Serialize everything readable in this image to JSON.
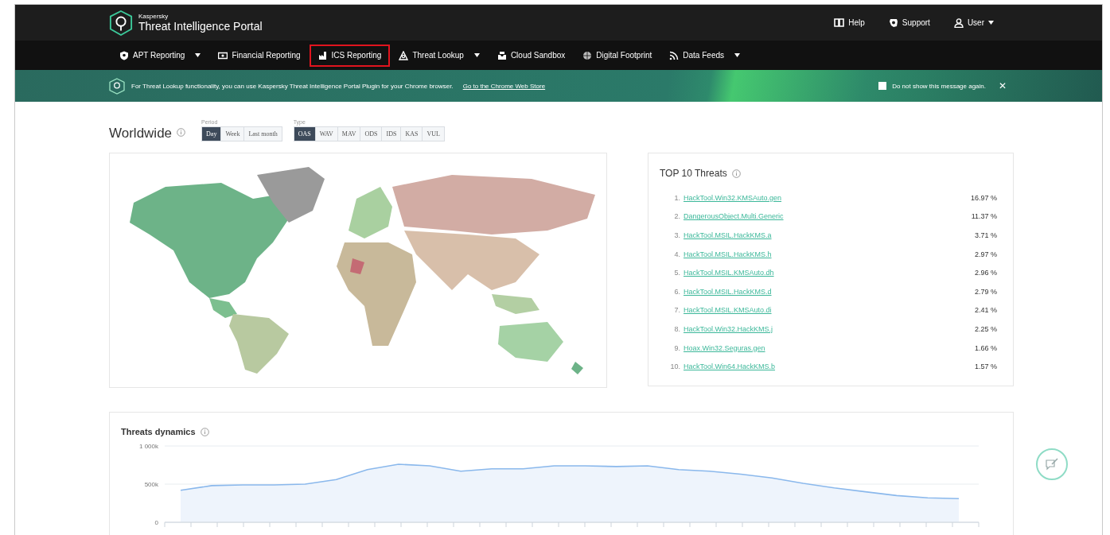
{
  "header": {
    "brand": "Kaspersky",
    "title": "Threat Intelligence Portal",
    "links": [
      {
        "label": "Help",
        "dropdown": false
      },
      {
        "label": "Support",
        "dropdown": false
      },
      {
        "label": "User",
        "dropdown": true
      }
    ]
  },
  "nav": [
    {
      "label": "APT Reporting",
      "dropdown": true,
      "highlighted": false
    },
    {
      "label": "Financial Reporting",
      "dropdown": false,
      "highlighted": false
    },
    {
      "label": "ICS Reporting",
      "dropdown": false,
      "highlighted": true
    },
    {
      "label": "Threat Lookup",
      "dropdown": true,
      "highlighted": false
    },
    {
      "label": "Cloud Sandbox",
      "dropdown": false,
      "highlighted": false
    },
    {
      "label": "Digital Footprint",
      "dropdown": false,
      "highlighted": false
    },
    {
      "label": "Data Feeds",
      "dropdown": true,
      "highlighted": false
    }
  ],
  "banner": {
    "text": "For Threat Lookup functionality, you can use Kaspersky Threat Intelligence Portal Plugin for your Chrome browser.",
    "link": "Go to the Chrome Web Store",
    "checkbox": {
      "label": "Do not show this message again.",
      "checked": false
    },
    "close": "✕"
  },
  "worldwide": {
    "title": "Worldwide",
    "period_label": "Period",
    "periods": [
      {
        "label": "Day",
        "selected": true
      },
      {
        "label": "Week",
        "selected": false
      },
      {
        "label": "Last month",
        "selected": false
      }
    ],
    "type_label": "Type",
    "types": [
      {
        "label": "OAS",
        "selected": true
      },
      {
        "label": "WAV",
        "selected": false
      },
      {
        "label": "MAV",
        "selected": false
      },
      {
        "label": "ODS",
        "selected": false
      },
      {
        "label": "IDS",
        "selected": false
      },
      {
        "label": "KAS",
        "selected": false
      },
      {
        "label": "VUL",
        "selected": false
      }
    ]
  },
  "top_threats": {
    "title": "TOP 10 Threats",
    "items": [
      {
        "rank": "1.",
        "name": "HackTool.Win32.KMSAuto.gen",
        "share": "16.97 %"
      },
      {
        "rank": "2.",
        "name": "DangerousObject.Multi.Generic",
        "share": "11.37 %"
      },
      {
        "rank": "3.",
        "name": "HackTool.MSIL.HackKMS.a",
        "share": "3.71 %"
      },
      {
        "rank": "4.",
        "name": "HackTool.MSIL.HackKMS.h",
        "share": "2.97 %"
      },
      {
        "rank": "5.",
        "name": "HackTool.MSIL.KMSAuto.dh",
        "share": "2.96 %"
      },
      {
        "rank": "6.",
        "name": "HackTool.MSIL.HackKMS.d",
        "share": "2.79 %"
      },
      {
        "rank": "7.",
        "name": "HackTool.MSIL.KMSAuto.di",
        "share": "2.41 %"
      },
      {
        "rank": "8.",
        "name": "HackTool.Win32.HackKMS.j",
        "share": "2.25 %"
      },
      {
        "rank": "9.",
        "name": "Hoax.Win32.Seguras.gen",
        "share": "1.66 %"
      },
      {
        "rank": "10.",
        "name": "HackTool.Win64.HackKMS.b",
        "share": "1.57 %"
      }
    ]
  },
  "dynamics": {
    "title": "Threats dynamics",
    "chart_data": {
      "type": "area",
      "ylim": [
        0,
        1000
      ],
      "yticks": [
        {
          "value": 0,
          "label": "0"
        },
        {
          "value": 500,
          "label": "500k"
        },
        {
          "value": 1000,
          "label": "1 000k"
        }
      ],
      "series": [
        {
          "color": "#8ab8ec",
          "values": [
            420,
            480,
            490,
            490,
            500,
            560,
            690,
            760,
            740,
            670,
            700,
            700,
            740,
            740,
            730,
            740,
            690,
            670,
            630,
            580,
            510,
            450,
            400,
            350,
            320,
            310
          ]
        }
      ]
    }
  }
}
